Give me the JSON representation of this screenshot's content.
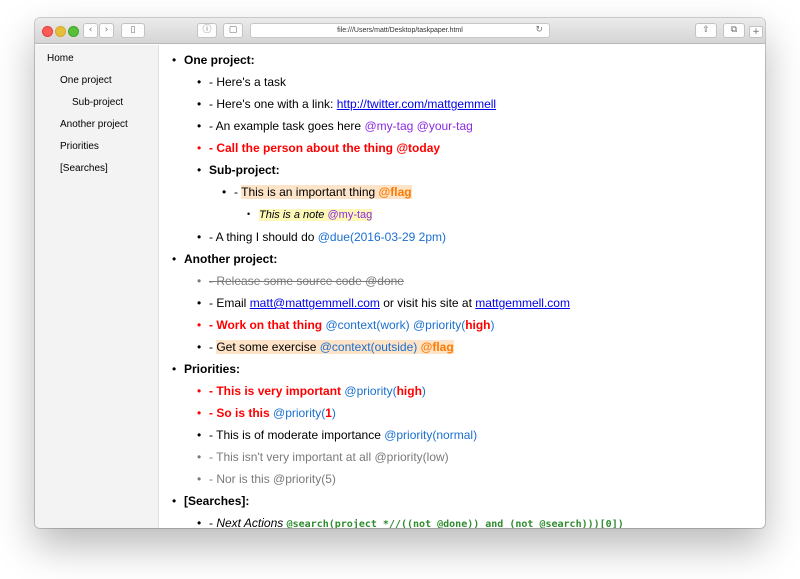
{
  "browser": {
    "url": "file:///Users/matt/Desktop/taskpaper.html",
    "back_glyph": "‹",
    "forward_glyph": "›",
    "sidebar_glyph": "▯",
    "info_glyph": "ⓘ",
    "lock_glyph": "▢",
    "reload_glyph": "↻",
    "share_glyph": "⇪",
    "tabs_glyph": "⧉",
    "newtab_glyph": "+"
  },
  "sidebar": {
    "items": [
      {
        "label": "Home"
      },
      {
        "label": "One project"
      },
      {
        "label": "Sub-project"
      },
      {
        "label": "Another project"
      },
      {
        "label": "Priorities"
      },
      {
        "label": "[Searches]"
      }
    ]
  },
  "doc": {
    "bullet": "•",
    "dash": "- ",
    "p1": {
      "title": "One project:",
      "t1": "Here's a task",
      "t2_text": "Here's one with a link: ",
      "t2_link": "http://twitter.com/mattgemmell",
      "t3_text": "An example task goes here ",
      "t3_tag1": "@my-tag",
      "t3_tag2": "@your-tag",
      "t4_text": "Call the person about the thing @today",
      "sub_title": "Sub-project:",
      "s1_text": "This is an important thing ",
      "s1_flag": "@flag",
      "note_text": "This is a note ",
      "note_tag": "@my-tag",
      "t5_text": "A thing I should do ",
      "t5_tag": "@due(2016-03-29 2pm)"
    },
    "p2": {
      "title": "Another project:",
      "t1": "Release some source code @done",
      "t2_text": "Email ",
      "t2_link1": "matt@mattgemmell.com",
      "t2_mid": " or visit his site at ",
      "t2_link2": "mattgemmell.com",
      "t3_text": "Work on that thing ",
      "t3_tag1": "@context(work)",
      "t3_tag2_open": "@priority(",
      "t3_tag2_val": "high",
      "t3_tag2_close": ")",
      "t4_text": "Get some exercise ",
      "t4_tag": "@context(outside)",
      "t4_flag": "@flag"
    },
    "p3": {
      "title": "Priorities:",
      "t1_text": "This is very important ",
      "t1_tag_open": "@priority(",
      "t1_tag_val": "high",
      "t1_tag_close": ")",
      "t2_text": "So is this ",
      "t2_tag_open": "@priority(",
      "t2_tag_val": "1",
      "t2_tag_close": ")",
      "t3_text": "This is of moderate importance ",
      "t3_tag": "@priority(normal)",
      "t4_text": "This isn't very important at all @priority(low)",
      "t5_text": "Nor is this @priority(5)"
    },
    "p4": {
      "title": "[Searches]:",
      "t1_text": "Next Actions ",
      "t1_query": "@search(project *//((not @done)) and (not @search)))[0])"
    }
  },
  "colors": {
    "red": "#ff0000",
    "purple_tag": "#8a2be2",
    "blue_tag": "#1a6fd0",
    "link": "#0000ee",
    "flag": "#ff7a00",
    "flag_highlight": "#fde3c7",
    "note_highlight": "#fdf7b8",
    "done_gray": "#7a7a7a",
    "search_green": "#2e8b2e"
  }
}
